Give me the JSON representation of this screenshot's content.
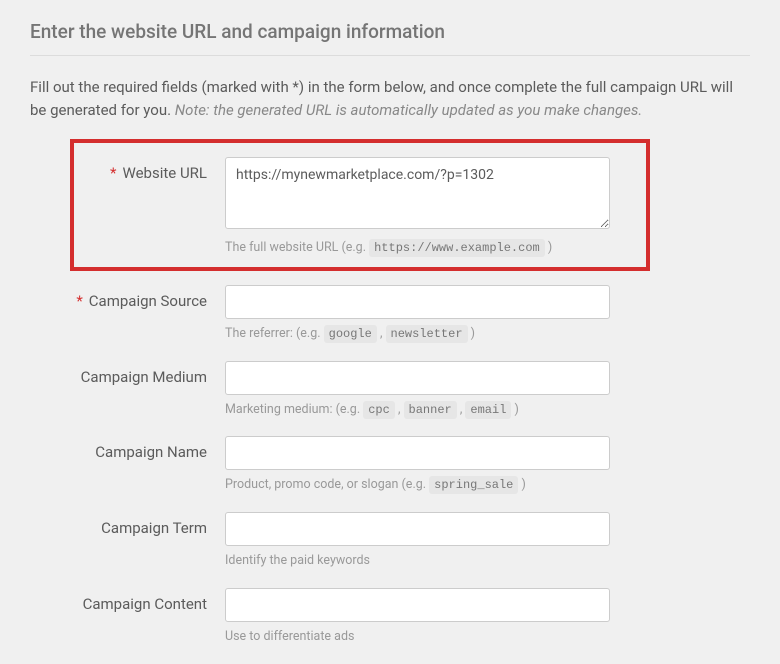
{
  "title": "Enter the website URL and campaign information",
  "intro": {
    "text": "Fill out the required fields (marked with *) in the form below, and once complete the full campaign URL will be generated for you. ",
    "note": "Note: the generated URL is automatically updated as you make changes."
  },
  "fields": {
    "websiteUrl": {
      "label": "Website URL",
      "value": "https://mynewmarketplace.com/?p=1302",
      "helperPrefix": "The full website URL (e.g. ",
      "helperCode": "https://www.example.com",
      "helperSuffix": " )"
    },
    "campaignSource": {
      "label": "Campaign Source",
      "value": "",
      "helperPrefix": "The referrer: (e.g. ",
      "code1": "google",
      "sep": " , ",
      "code2": "newsletter",
      "helperSuffix": " )"
    },
    "campaignMedium": {
      "label": "Campaign Medium",
      "value": "",
      "helperPrefix": "Marketing medium: (e.g. ",
      "code1": "cpc",
      "sep1": " , ",
      "code2": "banner",
      "sep2": " , ",
      "code3": "email",
      "helperSuffix": " )"
    },
    "campaignName": {
      "label": "Campaign Name",
      "value": "",
      "helperPrefix": "Product, promo code, or slogan (e.g. ",
      "code1": "spring_sale",
      "helperSuffix": " )"
    },
    "campaignTerm": {
      "label": "Campaign Term",
      "value": "",
      "helper": "Identify the paid keywords"
    },
    "campaignContent": {
      "label": "Campaign Content",
      "value": "",
      "helper": "Use to differentiate ads"
    }
  }
}
